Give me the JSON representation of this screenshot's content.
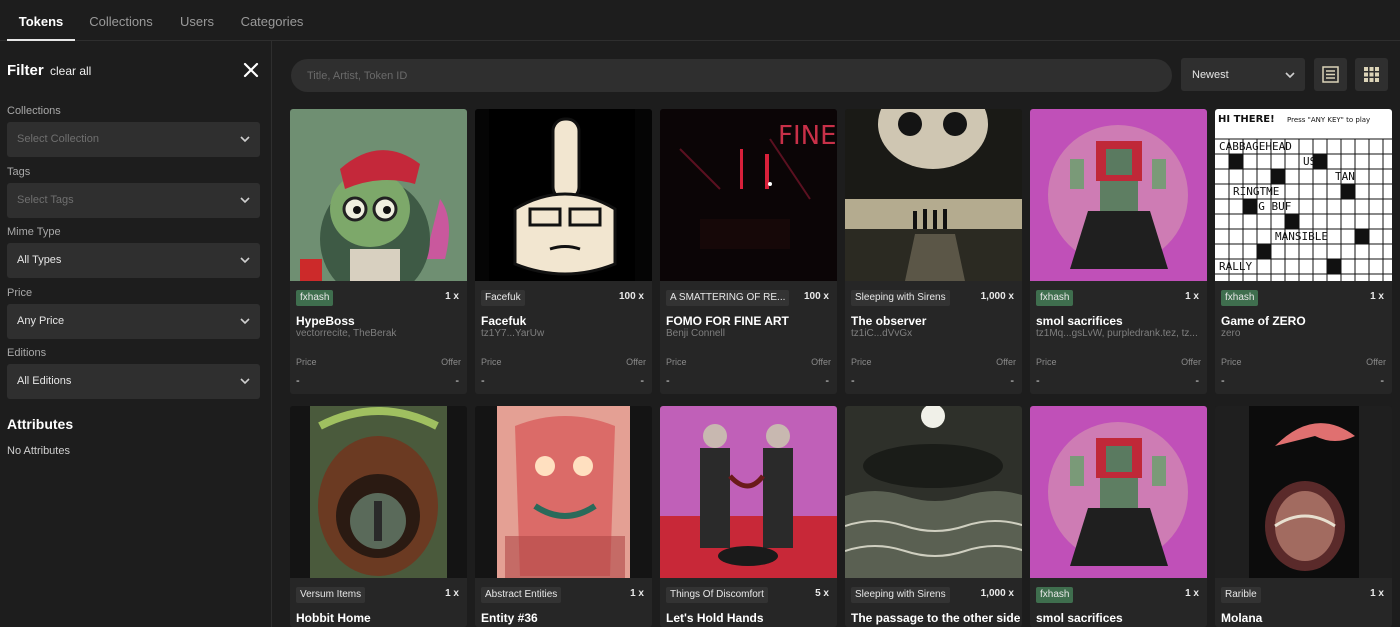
{
  "tabs": [
    {
      "label": "Tokens",
      "active": true
    },
    {
      "label": "Collections",
      "active": false
    },
    {
      "label": "Users",
      "active": false
    },
    {
      "label": "Categories",
      "active": false
    }
  ],
  "filter": {
    "title": "Filter",
    "clear_all": "clear all",
    "close_icon": "close-icon",
    "sections": [
      {
        "label": "Collections",
        "value": "",
        "placeholder": "Select Collection"
      },
      {
        "label": "Tags",
        "value": "",
        "placeholder": "Select Tags"
      },
      {
        "label": "Mime Type",
        "value": "All Types",
        "placeholder": ""
      },
      {
        "label": "Price",
        "value": "Any Price",
        "placeholder": ""
      },
      {
        "label": "Editions",
        "value": "All Editions",
        "placeholder": ""
      }
    ],
    "attributes_title": "Attributes",
    "attributes_empty": "No Attributes"
  },
  "search": {
    "placeholder": "Title, Artist, Token ID",
    "value": ""
  },
  "sort": {
    "selected": "Newest"
  },
  "view_toggle": {
    "list_icon": "list-view-icon",
    "grid_icon": "grid-view-icon",
    "active": "grid"
  },
  "labels": {
    "price": "Price",
    "offer": "Offer"
  },
  "colors": {
    "accent": "#ffffff",
    "badge_fxhash": "#3f6e4e",
    "background": "#1d1d1d",
    "card": "#262626"
  },
  "cards": [
    {
      "platform": "fxhash",
      "platform_style": "green",
      "editions": "1 x",
      "title": "HypeBoss",
      "artist": "vectorrecite, TheBerak",
      "price": "-",
      "offer": "-"
    },
    {
      "platform": "Facefuk",
      "platform_style": "",
      "editions": "100 x",
      "title": "Facefuk",
      "artist": "tz1Y7...YarUw",
      "price": "-",
      "offer": "-"
    },
    {
      "platform": "A SMATTERING OF RE...",
      "platform_style": "",
      "editions": "100 x",
      "title": "FOMO FOR FINE ART",
      "artist": "Benji Connell",
      "price": "-",
      "offer": "-"
    },
    {
      "platform": "Sleeping with Sirens",
      "platform_style": "",
      "editions": "1,000 x",
      "title": "The observer",
      "artist": "tz1iC...dVvGx",
      "price": "-",
      "offer": "-"
    },
    {
      "platform": "fxhash",
      "platform_style": "green",
      "editions": "1 x",
      "title": "smol sacrifices",
      "artist": "tz1Mq...gsLvW, purpledrank.tez, tz...",
      "price": "-",
      "offer": "-"
    },
    {
      "platform": "fxhash",
      "platform_style": "green",
      "editions": "1 x",
      "title": "Game of ZERO",
      "artist": "zero",
      "price": "-",
      "offer": "-"
    },
    {
      "platform": "Versum Items",
      "platform_style": "",
      "editions": "1 x",
      "title": "Hobbit Home",
      "artist": "",
      "price": "",
      "offer": ""
    },
    {
      "platform": "Abstract Entities",
      "platform_style": "",
      "editions": "1 x",
      "title": "Entity #36",
      "artist": "",
      "price": "",
      "offer": ""
    },
    {
      "platform": "Things Of Discomfort",
      "platform_style": "",
      "editions": "5 x",
      "title": "Let's Hold Hands",
      "artist": "",
      "price": "",
      "offer": ""
    },
    {
      "platform": "Sleeping with Sirens",
      "platform_style": "",
      "editions": "1,000 x",
      "title": "The passage to the other side",
      "artist": "",
      "price": "",
      "offer": ""
    },
    {
      "platform": "fxhash",
      "platform_style": "green",
      "editions": "1 x",
      "title": "smol sacrifices",
      "artist": "",
      "price": "",
      "offer": ""
    },
    {
      "platform": "Rarible",
      "platform_style": "",
      "editions": "1 x",
      "title": "Molana",
      "artist": "",
      "price": "",
      "offer": ""
    }
  ],
  "artwork_texts": {
    "crossword_header": "HI THERE!",
    "crossword_sub": "Press \"ANY KEY\" to play",
    "crossword_rows": [
      "CABBAGEHEAD",
      "US",
      "TAN",
      "RINGTME",
      "SNG BUF",
      "MANSIBLE",
      "RALLY"
    ],
    "fine_text": "FINE"
  }
}
